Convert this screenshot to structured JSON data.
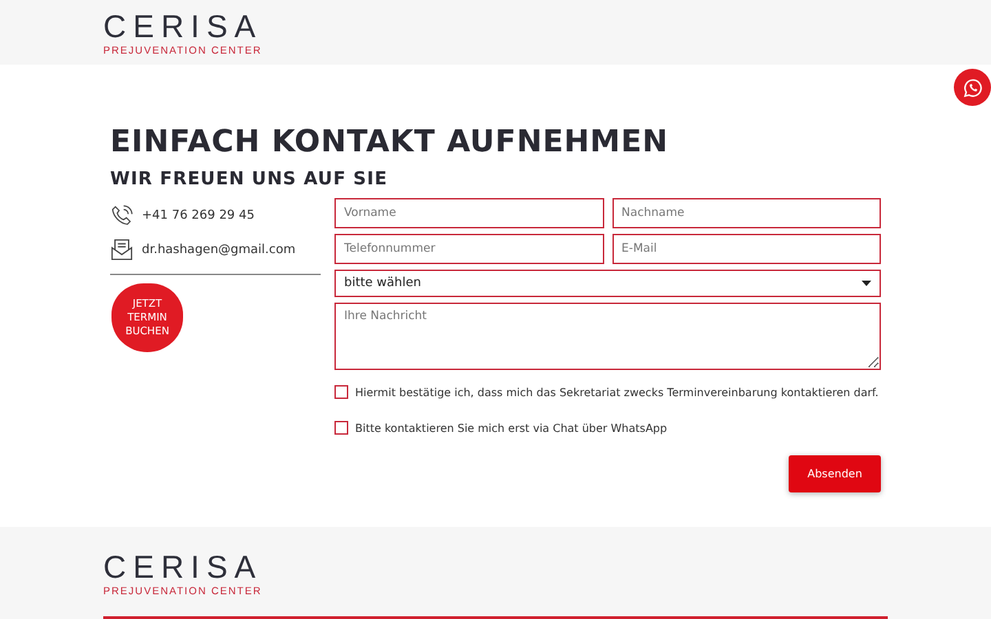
{
  "header": {
    "logo": {
      "name": "CERISA",
      "tagline": "PREJUVENATION CENTER"
    }
  },
  "title": "EINFACH KONTAKT AUFNEHMEN",
  "subtitle": "WIR FREUEN UNS AUF SIE",
  "contacts": [
    {
      "kind": "phone",
      "text": "+41 76 269 29 45"
    },
    {
      "kind": "email",
      "text": "dr.hashagen@gmail.com"
    }
  ],
  "booking_badge": "JETZT\nTERMIN\nBUCHEN",
  "form": {
    "fields": [
      {
        "placeholder": "Vorname"
      },
      {
        "placeholder": "Nachname"
      },
      {
        "placeholder": "Telefonnummer"
      },
      {
        "placeholder": "E-Mail"
      }
    ],
    "select": {
      "value": "bitte wählen"
    },
    "message": {
      "placeholder": "Ihre Nachricht"
    },
    "checkboxes": [
      {
        "label": "Hiermit bestätige ich, dass mich das Sekretariat zwecks Terminvereinbarung kontaktieren darf.",
        "checked": false
      },
      {
        "label": "Bitte kontaktieren Sie mich erst via Chat über WhatsApp",
        "checked": false
      }
    ],
    "submit": "Absenden"
  },
  "footer": {
    "logo": {
      "name": "CERISA",
      "tagline": "PREJUVENATION CENTER"
    }
  }
}
